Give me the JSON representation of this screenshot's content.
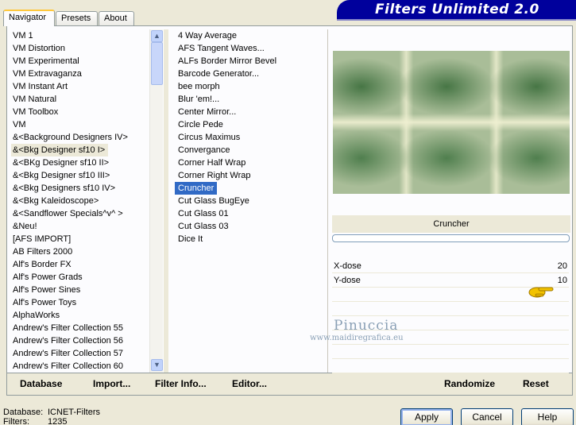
{
  "tabs": [
    {
      "label": "Navigator"
    },
    {
      "label": "Presets"
    },
    {
      "label": "About"
    }
  ],
  "banner_title": "Filters Unlimited 2.0",
  "categories": [
    "VM 1",
    "VM Distortion",
    "VM Experimental",
    "VM Extravaganza",
    "VM Instant Art",
    "VM Natural",
    "VM Toolbox",
    "VM",
    "&<Background Designers IV>",
    "&<Bkg Designer sf10 I>",
    "&<BKg Designer sf10 II>",
    "&<Bkg Designer sf10 III>",
    "&<Bkg Designers sf10 IV>",
    "&<Bkg Kaleidoscope>",
    "&<Sandflower Specials^v^ >",
    "&Neu!",
    "[AFS IMPORT]",
    "AB Filters 2000",
    "Alf's Border FX",
    "Alf's Power Grads",
    "Alf's Power Sines",
    "Alf's Power Toys",
    "AlphaWorks",
    "Andrew's Filter Collection 55",
    "Andrew's Filter Collection 56",
    "Andrew's Filter Collection 57",
    "Andrew's Filter Collection 60"
  ],
  "selected_category": "&<Bkg Designer sf10 I>",
  "filters": [
    "4 Way Average",
    "AFS Tangent Waves...",
    "ALFs Border Mirror Bevel",
    "Barcode Generator...",
    "bee morph",
    "Blur 'em!...",
    "Center Mirror...",
    "Circle Pede",
    "Circus Maximus",
    "Convergance",
    "Corner Half Wrap",
    "Corner Right Wrap",
    "Cruncher",
    "Cut Glass  BugEye",
    "Cut Glass 01",
    "Cut Glass 03",
    "Dice It"
  ],
  "selected_filter": "Cruncher",
  "filter_name": "Cruncher",
  "params": [
    {
      "label": "X-dose",
      "value": "20"
    },
    {
      "label": "Y-dose",
      "value": "10"
    }
  ],
  "watermark": {
    "name": "Pinuccia",
    "url": "www.maidiregrafica.eu"
  },
  "bottom_links": {
    "database": "Database",
    "import": "Import...",
    "filter_info": "Filter Info...",
    "editor": "Editor...",
    "randomize": "Randomize",
    "reset": "Reset"
  },
  "status": {
    "database_label": "Database:",
    "database_value": "ICNET-Filters",
    "filters_label": "Filters:",
    "filters_value": "1235"
  },
  "buttons": {
    "apply": "Apply",
    "cancel": "Cancel",
    "help": "Help"
  },
  "colors": {
    "banner": "#00009c",
    "selection": "#316ac5",
    "dialog_bg": "#ece9d8"
  }
}
